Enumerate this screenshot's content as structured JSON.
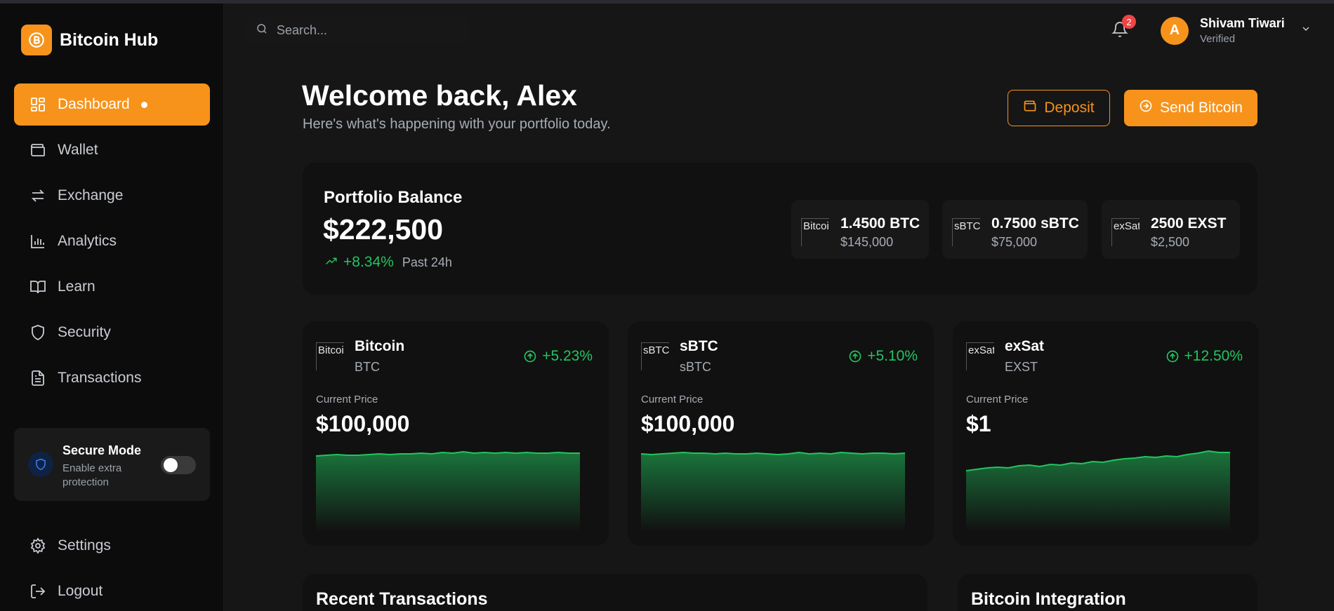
{
  "brand": {
    "name": "Bitcoin Hub"
  },
  "nav": [
    {
      "label": "Dashboard",
      "active": true
    },
    {
      "label": "Wallet"
    },
    {
      "label": "Exchange"
    },
    {
      "label": "Analytics"
    },
    {
      "label": "Learn"
    },
    {
      "label": "Security"
    },
    {
      "label": "Transactions"
    }
  ],
  "secure_mode": {
    "title": "Secure Mode",
    "subtitle": "Enable extra protection",
    "enabled": false
  },
  "nav_bottom": [
    {
      "label": "Settings"
    },
    {
      "label": "Logout"
    }
  ],
  "search": {
    "placeholder": "Search..."
  },
  "notifications": {
    "count": "2"
  },
  "user": {
    "initial": "A",
    "name": "Shivam Tiwari",
    "status": "Verified"
  },
  "header": {
    "title": "Welcome back, Alex",
    "subtitle": "Here's what's happening with your portfolio today.",
    "deposit_label": "Deposit",
    "send_label": "Send Bitcoin"
  },
  "portfolio": {
    "title": "Portfolio Balance",
    "balance": "$222,500",
    "change": "+8.34%",
    "change_label": "Past 24h",
    "holdings": [
      {
        "amount": "1.4500 BTC",
        "value": "$145,000",
        "img_alt": "Bitcoin"
      },
      {
        "amount": "0.7500 sBTC",
        "value": "$75,000",
        "img_alt": "sBTC"
      },
      {
        "amount": "2500 EXST",
        "value": "$2,500",
        "img_alt": "exSat"
      }
    ]
  },
  "coins": [
    {
      "name": "Bitcoin",
      "symbol": "BTC",
      "change": "+5.23%",
      "price_label": "Current Price",
      "price": "$100,000",
      "img_alt": "Bitcoin"
    },
    {
      "name": "sBTC",
      "symbol": "sBTC",
      "change": "+5.10%",
      "price_label": "Current Price",
      "price": "$100,000",
      "img_alt": "sBTC"
    },
    {
      "name": "exSat",
      "symbol": "EXST",
      "change": "+12.50%",
      "price_label": "Current Price",
      "price": "$1",
      "img_alt": "exSat"
    }
  ],
  "bottom": {
    "transactions_title": "Recent Transactions",
    "integration_title": "Bitcoin Integration"
  },
  "colors": {
    "accent": "#f7931a",
    "positive": "#22c55e",
    "badge": "#ef4444"
  }
}
